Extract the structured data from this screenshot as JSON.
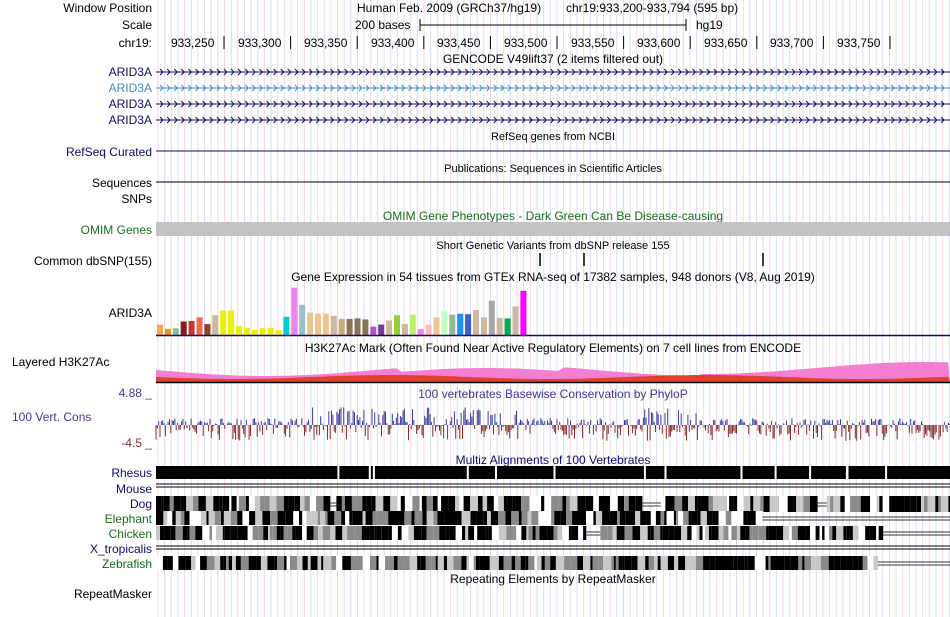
{
  "colors": {
    "navy": "#0c0c78",
    "light_blue": "#3d8ec7",
    "omim_green": "#16701a",
    "phylop_pos": "#3a3a9e",
    "phylop_neg": "#8c2a2a",
    "h3k27_pink": "#f47fd2",
    "h3k27_red": "#e0402c",
    "omim_gray": "#c3c3c3",
    "grid_pink": "#f1d8e4",
    "grid_blue": "#d8dcf4"
  },
  "header": {
    "window_position_label": "Window Position",
    "assembly_text": "Human Feb. 2009 (GRCh37/hg19)",
    "position_text": "chr19:933,200-933,794 (595 bp)",
    "scale_label": "Scale",
    "scale_bar_text": "200 bases",
    "scale_db": "hg19",
    "chrom_label": "chr19:",
    "ticks": [
      "933,250",
      "933,300",
      "933,350",
      "933,400",
      "933,450",
      "933,500",
      "933,550",
      "933,600",
      "933,650",
      "933,700",
      "933,750"
    ]
  },
  "tracks": {
    "gencode": {
      "title": "GENCODE V49lift37 (2 items filtered out)",
      "items": [
        {
          "label": "ARID3A",
          "color": "#0c0c78"
        },
        {
          "label": "ARID3A",
          "color": "#3d8ec7"
        },
        {
          "label": "ARID3A",
          "color": "#0c0c78"
        },
        {
          "label": "ARID3A",
          "color": "#0c0c78"
        }
      ]
    },
    "refseq": {
      "title": "RefSeq genes from NCBI",
      "label": "RefSeq Curated"
    },
    "publications": {
      "title": "Publications: Sequences in Scientific Articles",
      "label": "Sequences"
    },
    "snps": {
      "label": "SNPs"
    },
    "omim": {
      "title": "OMIM Gene Phenotypes - Dark Green Can Be Disease-causing",
      "label": "OMIM Genes"
    },
    "dbsnp": {
      "title": "Short Genetic Variants from dbSNP release 155",
      "label": "Common dbSNP(155)"
    },
    "gtex": {
      "title": "Gene Expression in 54 tissues from GTEx RNA-seq of 17382 samples, 948 donors (V8, Aug 2019)",
      "label": "ARID3A",
      "bar_colors": [
        "#ffa54f",
        "#ee9a00",
        "#8fbc8f",
        "#8b1a1a",
        "#cd3333",
        "#ee6a50",
        "#8b4726",
        "#cdb79e",
        "#eeee00",
        "#eeee00",
        "#eeee00",
        "#eeee00",
        "#eeee00",
        "#eeee00",
        "#eeee00",
        "#eeee00",
        "#00cdcd",
        "#ee82ee",
        "#9ac0cd",
        "#eec591",
        "#eec591",
        "#eec591",
        "#cdb79e",
        "#cdaa7d",
        "#8b7355",
        "#8b7355",
        "#8b7355",
        "#b452cd",
        "#7a378b",
        "#cdb79e",
        "#9acd32",
        "#cdb79e",
        "#bcee68",
        "#ee82ee",
        "#ffb6c1",
        "#eec591",
        "#c1ffc1",
        "#8fbc8f",
        "#1e90ff",
        "#3a5fcd",
        "#cdb79e",
        "#cdb79e",
        "#a6a6a6",
        "#cdb79e",
        "#00ab52",
        "#cdb79e",
        "#ff00ff"
      ],
      "values": [
        0.2,
        0.12,
        0.13,
        0.26,
        0.27,
        0.34,
        0.21,
        0.38,
        0.47,
        0.47,
        0.17,
        0.14,
        0.1,
        0.13,
        0.14,
        0.09,
        0.35,
        0.91,
        0.58,
        0.43,
        0.41,
        0.41,
        0.37,
        0.31,
        0.31,
        0.32,
        0.3,
        0.16,
        0.2,
        0.28,
        0.38,
        0.21,
        0.39,
        0.11,
        0.2,
        0.34,
        0.47,
        0.39,
        0.41,
        0.4,
        0.48,
        0.34,
        0.66,
        0.33,
        0.32,
        0.55,
        0.85
      ]
    },
    "h3k27ac": {
      "title": "H3K27Ac Mark (Often Found Near Active Regulatory Elements) on 7 cell lines from ENCODE",
      "label": "Layered H3K27Ac"
    },
    "conservation": {
      "title": "100 vertebrates Basewise Conservation by PhyloP",
      "label": "100 Vert. Cons",
      "max_label": "4.88 _",
      "min_label": "-4.5 _"
    },
    "multiz": {
      "title": "Multiz Alignments of 100 Vertebrates",
      "species": [
        {
          "label": "Rhesus",
          "color": "#0c0c78"
        },
        {
          "label": "Mouse",
          "color": "#0c0c78"
        },
        {
          "label": "Dog",
          "color": "#0c0c78"
        },
        {
          "label": "Elephant",
          "color": "#16701a"
        },
        {
          "label": "Chicken",
          "color": "#16701a"
        },
        {
          "label": "X_tropicalis",
          "color": "#0c0c78"
        },
        {
          "label": "Zebrafish",
          "color": "#16701a"
        }
      ]
    },
    "repeatmasker": {
      "title": "Repeating Elements by RepeatMasker",
      "label": "RepeatMasker"
    }
  }
}
